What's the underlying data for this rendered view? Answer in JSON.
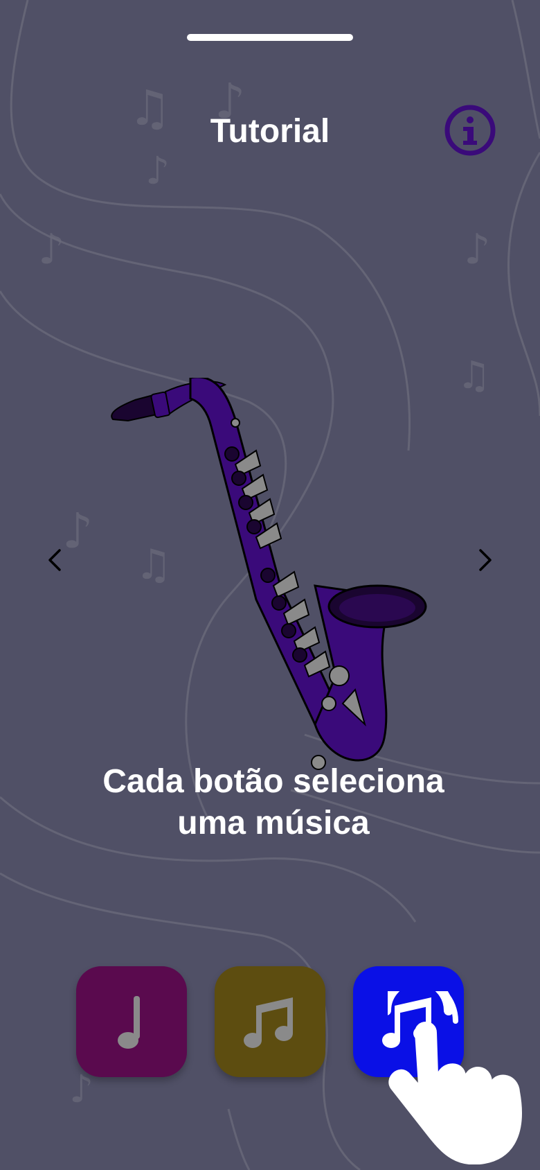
{
  "screen": {
    "title": "Tutorial",
    "caption_line1": "Cada botão seleciona",
    "caption_line2": "uma música"
  },
  "icons": {
    "info": "info-icon",
    "prev": "chevron-left-icon",
    "next": "chevron-right-icon",
    "illustration": "saxophone-icon",
    "gesture": "tap-hand-icon"
  },
  "song_buttons": [
    {
      "icon": "quarter-note-icon",
      "color": "#5a0a4e",
      "selected": false
    },
    {
      "icon": "beamed-eighth-notes-icon",
      "color": "#5d4d10",
      "selected": false
    },
    {
      "icon": "beamed-eighth-notes-icon",
      "color": "#0a10e6",
      "selected": true
    }
  ],
  "colors": {
    "background": "#505066",
    "accent_purple": "#3a0a7a",
    "text": "#ffffff"
  }
}
